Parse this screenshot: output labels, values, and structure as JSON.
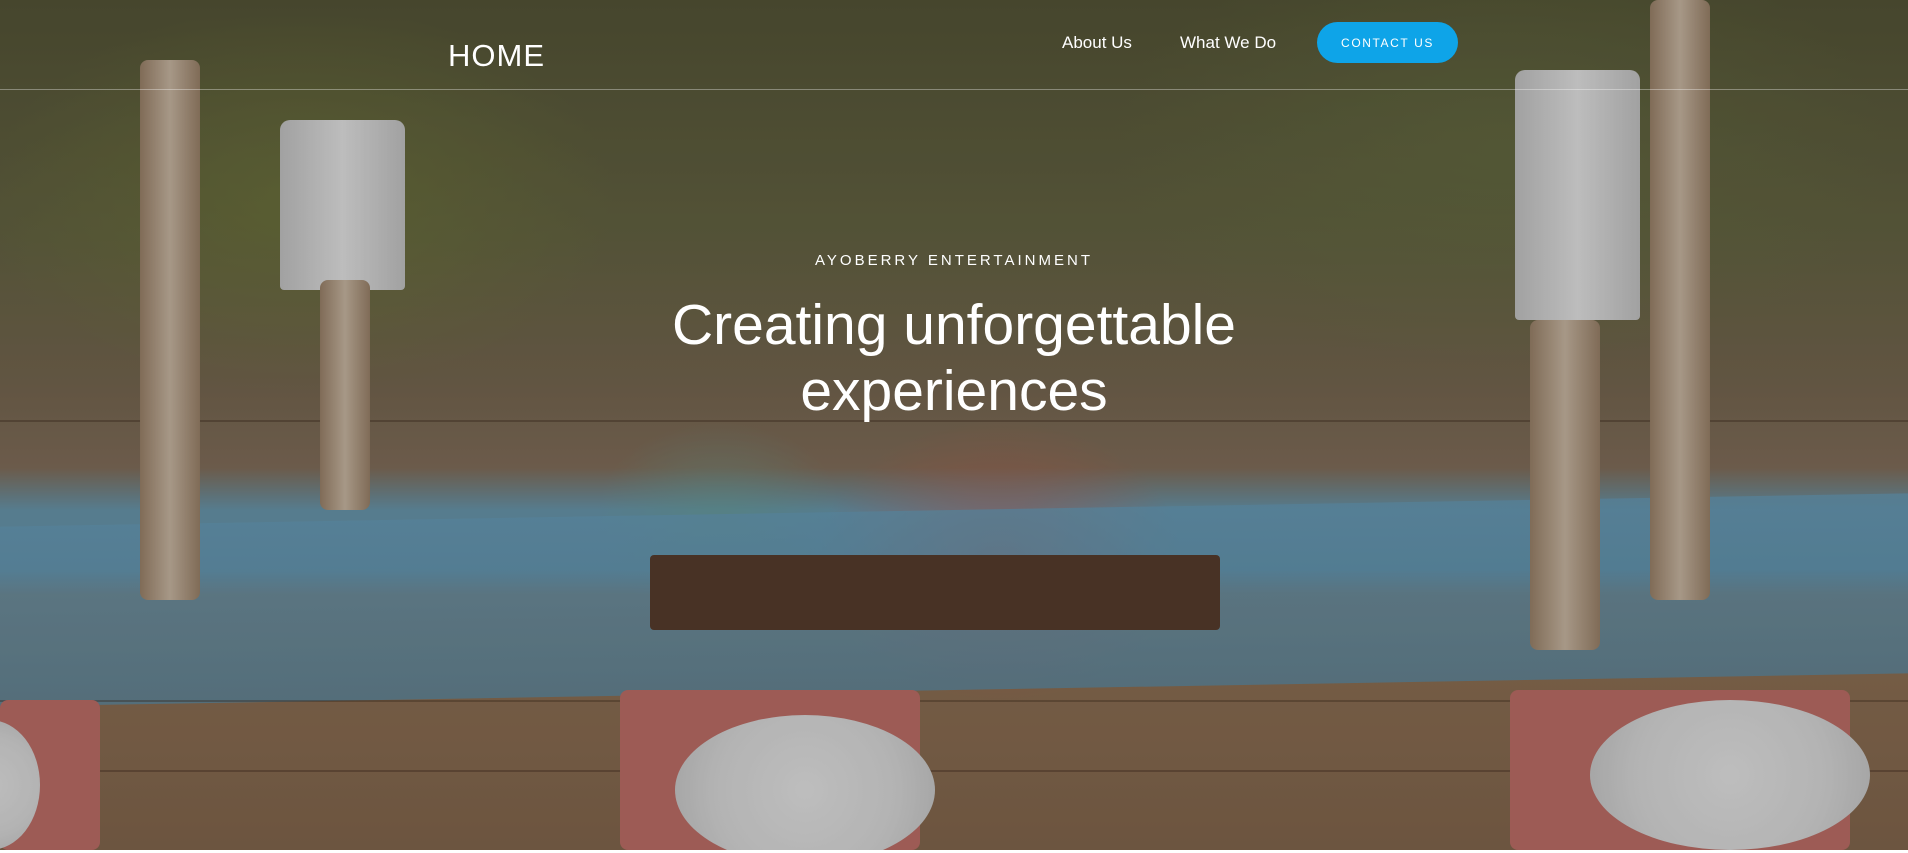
{
  "nav": {
    "brand": "HOME",
    "links": [
      "About Us",
      "What We Do"
    ],
    "cta": "CONTACT US",
    "cta_color": "#0ea4e8"
  },
  "hero": {
    "eyebrow": "AYOBERRY ENTERTAINMENT",
    "headline": "Creating unforgettable experiences"
  }
}
